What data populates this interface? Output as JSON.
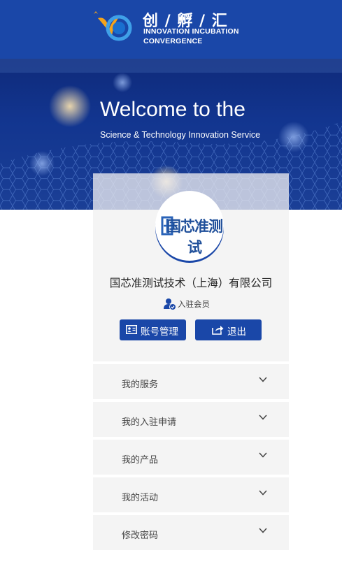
{
  "header": {
    "brand_cn": "创 / 孵 / 汇",
    "brand_en_line1": "INNOVATION INCUBATION",
    "brand_en_line2": "CONVERGENCE"
  },
  "banner": {
    "welcome": "Welcome to the",
    "subtitle": "Science & Technology Innovation Service"
  },
  "profile": {
    "logo_text": "国芯准测试",
    "company_name": "国芯准测试技术（上海）有限公司",
    "member_label": "入驻会员",
    "account_button": "账号管理",
    "logout_button": "退出"
  },
  "menu": {
    "items": [
      {
        "label": "我的服务"
      },
      {
        "label": "我的入驻申请"
      },
      {
        "label": "我的产品"
      },
      {
        "label": "我的活动"
      },
      {
        "label": "修改密码"
      }
    ]
  },
  "colors": {
    "brand_blue": "#1a47a8",
    "card_bg": "#f4f4f4",
    "logo_orange": "#f5a31a"
  },
  "icons": {
    "logo": "brand-logo-icon",
    "member": "member-verified-icon",
    "account": "id-card-icon",
    "logout": "share-exit-icon",
    "chevron": "chevron-down-icon"
  }
}
